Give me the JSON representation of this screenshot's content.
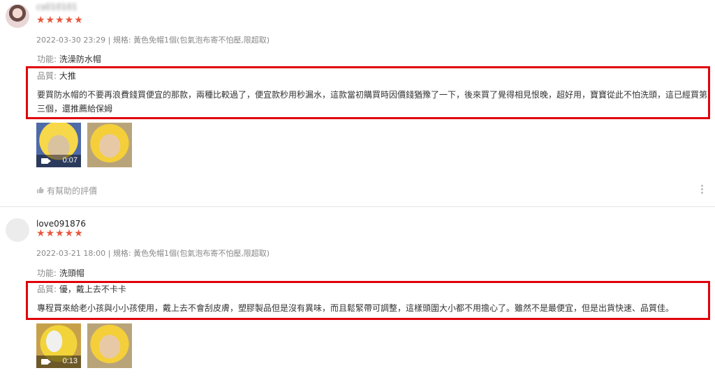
{
  "reviews": [
    {
      "username": "cs010101",
      "stars": "★★★★★",
      "meta": "2022-03-30 23:29 | 規格: 黃色免帽1個(包氣泡布寄不怕壓,限超取)",
      "function_label": "功能: ",
      "function_value": "洗澡防水帽",
      "quality_label": "品質: ",
      "quality_value": "大推",
      "body": "要買防水帽的不要再浪費錢買便宜的那款，兩種比較過了，便宜款秒用秒漏水，這款當初購買時因價錢猶豫了一下，後來買了覺得相見恨晚，超好用，寶寶從此不怕洗頭，這已經買第三個，還推薦給保姆",
      "video_duration": "0:07",
      "helpful_label": "有幫助的評價"
    },
    {
      "username": "love091876",
      "stars": "★★★★★",
      "meta": "2022-03-21 18:00 | 規格: 黃色免帽1個(包氣泡布寄不怕壓,限超取)",
      "function_label": "功能: ",
      "function_value": "洗頭帽",
      "quality_label": "品質: ",
      "quality_value": "優，戴上去不卡卡",
      "body": "專程買來給老小孩與小小孩使用，戴上去不會刮皮膚，塑膠製品但是沒有異味，而且鬆緊帶可調整，這樣頭圍大小都不用擔心了。雖然不是最便宜，但是出貨快速、品質佳。",
      "video_duration": "0:13"
    }
  ],
  "colors": {
    "stars": "#e8573e",
    "highlight": "#e0000b"
  },
  "icons": [
    "camera-icon",
    "thumbs-up-icon",
    "more-options-icon"
  ]
}
